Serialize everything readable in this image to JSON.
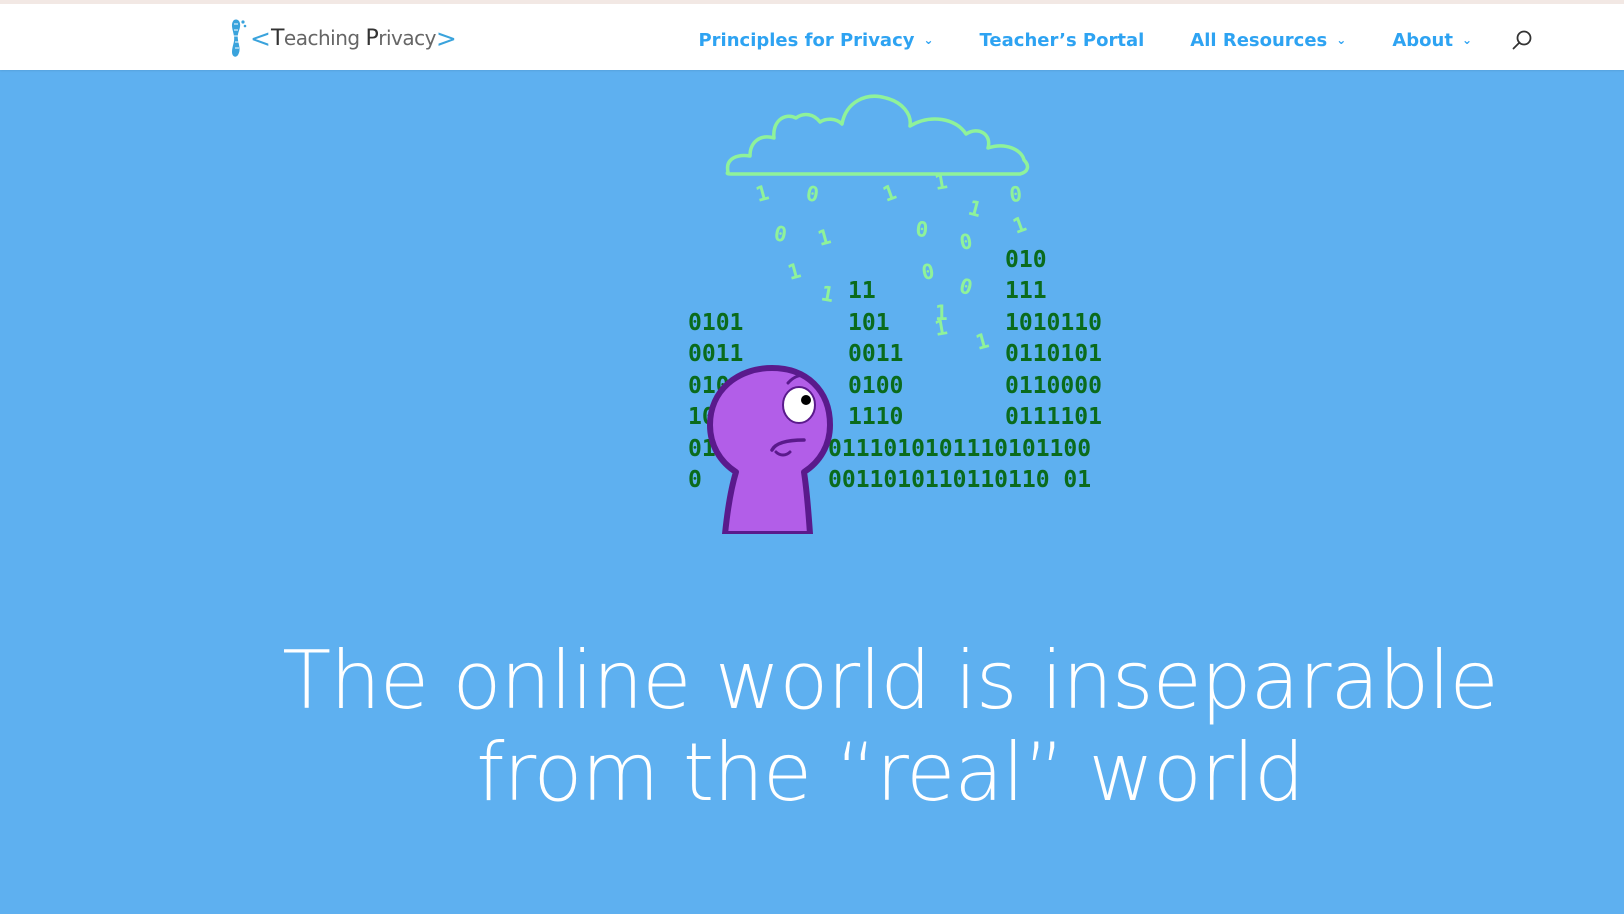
{
  "logo": {
    "bracket_open": "<",
    "cap_t": "T",
    "word_1_rest": "eaching",
    "cap_p": "P",
    "word_2_rest": "rivacy",
    "bracket_close": ">"
  },
  "nav": {
    "items": [
      {
        "label": "Principles for Privacy",
        "has_dropdown": true
      },
      {
        "label": "Teacher’s Portal",
        "has_dropdown": false
      },
      {
        "label": "All Resources",
        "has_dropdown": true
      },
      {
        "label": "About",
        "has_dropdown": true
      }
    ],
    "search_icon": "search-icon"
  },
  "hero": {
    "headline_line_1": "The online world is inseparable",
    "headline_line_2": "from the “real” world"
  },
  "illustration": {
    "left_column": [
      "0101",
      "0011",
      "01001101",
      "10110000",
      "01",
      "0"
    ],
    "middle_column": [
      "11",
      "101",
      "0011",
      "0100",
      "1110"
    ],
    "right_column": [
      "010",
      "111",
      "1010110",
      "0110101",
      "0110000",
      "0111101"
    ],
    "row_5_right": "0111010101110101100",
    "row_6_right": "0011010110110110 01",
    "falling_digits": [
      "1",
      "0",
      "1",
      "1",
      "1",
      "0",
      "0",
      "1",
      "0",
      "0",
      "1",
      "1",
      "1",
      "0",
      "0",
      "1",
      "1",
      "1"
    ]
  },
  "colors": {
    "page_background": "#5eb0f0",
    "nav_link": "#2ea3f2",
    "binary_dark": "#0a6b1c",
    "binary_light": "#8ff29a",
    "figure_fill": "#b25ee8",
    "figure_outline": "#5a1a8c"
  }
}
